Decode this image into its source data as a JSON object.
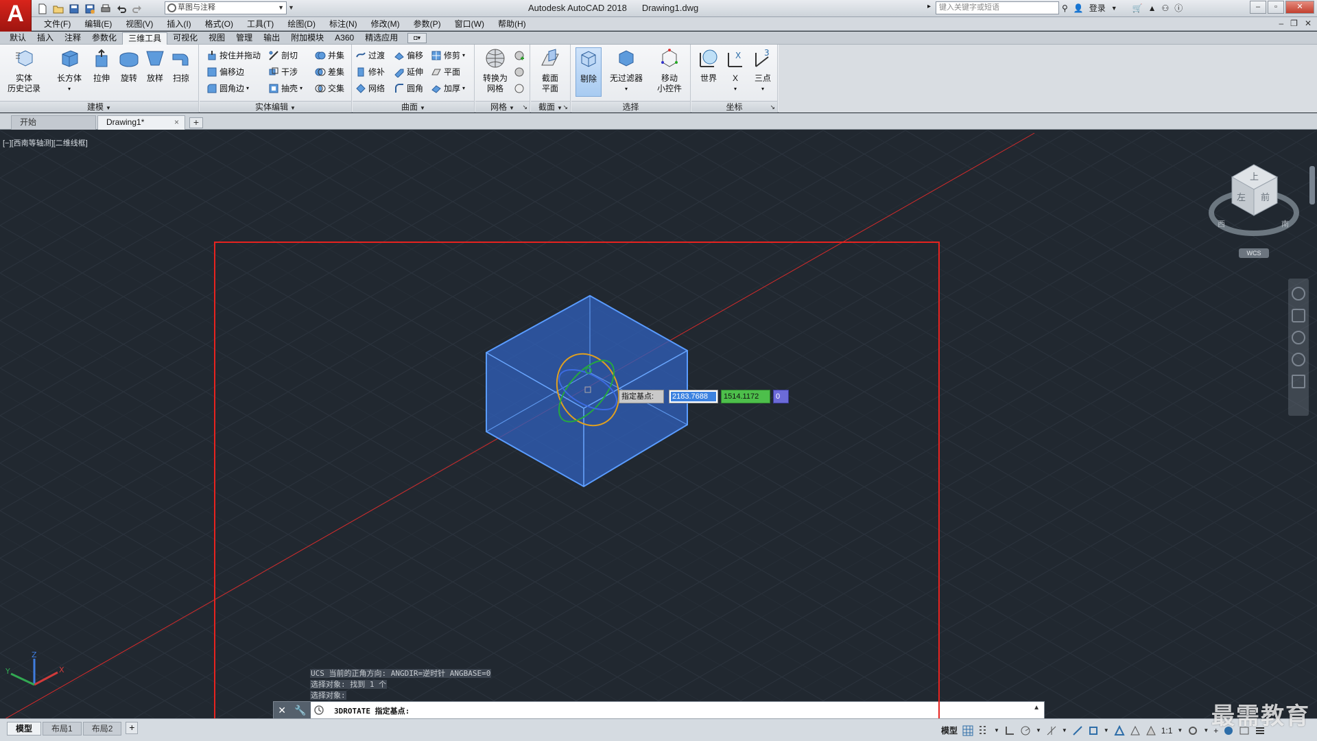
{
  "titlebar": {
    "app_logo": "A",
    "workspace": "草图与注释",
    "app_name": "Autodesk AutoCAD 2018",
    "doc_name": "Drawing1.dwg",
    "search_placeholder": "键入关键字或短语",
    "login_label": "登录"
  },
  "menubar": {
    "items": [
      "文件(F)",
      "编辑(E)",
      "视图(V)",
      "插入(I)",
      "格式(O)",
      "工具(T)",
      "绘图(D)",
      "标注(N)",
      "修改(M)",
      "参数(P)",
      "窗口(W)",
      "帮助(H)"
    ]
  },
  "ribbon_tabs": [
    "默认",
    "插入",
    "注释",
    "参数化",
    "三维工具",
    "可视化",
    "视图",
    "管理",
    "输出",
    "附加模块",
    "A360",
    "精选应用"
  ],
  "active_ribbon_tab": "三维工具",
  "ribbon": {
    "modeling": {
      "title": "建模",
      "history": "实体\n历史记录",
      "history_l1": "实体",
      "history_l2": "历史记录",
      "box": "长方体",
      "extrude": "拉伸",
      "revolve": "旋转",
      "loft": "放样",
      "sweep": "扫掠"
    },
    "solid_edit": {
      "title": "实体编辑",
      "presspull": "按住并拖动",
      "slice": "剖切",
      "union": "并集",
      "offset_edge": "偏移边",
      "interfere": "干涉",
      "subtract": "差集",
      "fillet_edge": "圆角边",
      "shell": "抽壳",
      "intersect": "交集"
    },
    "surface": {
      "title": "曲面",
      "blend": "过渡",
      "offset": "偏移",
      "trim": "修剪",
      "patch": "修补",
      "extend": "延伸",
      "planar": "平面",
      "network": "网络",
      "fillet": "圆角",
      "thicken": "加厚"
    },
    "mesh": {
      "title": "网格",
      "convert_l1": "转换为",
      "convert_l2": "网格"
    },
    "section": {
      "title": "截面",
      "plane_l1": "截面",
      "plane_l2": "平面"
    },
    "selection": {
      "title": "选择",
      "cull": "剔除",
      "nofilter": "无过滤器",
      "gizmo_l1": "移动",
      "gizmo_l2": "小控件"
    },
    "coordinates": {
      "title": "坐标",
      "world": "世界",
      "x": "X",
      "three_point": "三点"
    }
  },
  "file_tabs": {
    "start": "开始",
    "drawing": "Drawing1*",
    "close": "×",
    "add": "+"
  },
  "viewport": {
    "label": "[−][西南等轴测][二维线框]",
    "viewcube": {
      "top": "上",
      "left": "左",
      "front": "前",
      "compass_west": "西",
      "compass_south": "南"
    },
    "wcs": "WCS",
    "dynamic_input": {
      "prompt": "指定基点:",
      "x": "2183.7688",
      "y": "1514.1172",
      "z": "0"
    },
    "ucs_x": "X",
    "ucs_y": "Y",
    "ucs_z": "Z"
  },
  "command": {
    "history": [
      "UCS 当前的正角方向:  ANGDIR=逆时针  ANGBASE=0",
      "选择对象: 找到 1 个",
      "选择对象:"
    ],
    "prompt": "3DROTATE 指定基点:"
  },
  "statusbar": {
    "layout_tabs": [
      "模型",
      "布局1",
      "布局2"
    ],
    "active_layout": "模型",
    "model_label": "模型",
    "scale": "1:1"
  },
  "watermark": "最需教育",
  "colors": {
    "viewport_bg": "#212830",
    "solid_fill": "#2f5fb8",
    "solid_edge": "#5a9cff",
    "selection_rect": "#e8231f",
    "dyn_x": "#3c82e0",
    "dyn_y": "#4dbf4b",
    "dyn_z": "#6c6bd8"
  }
}
